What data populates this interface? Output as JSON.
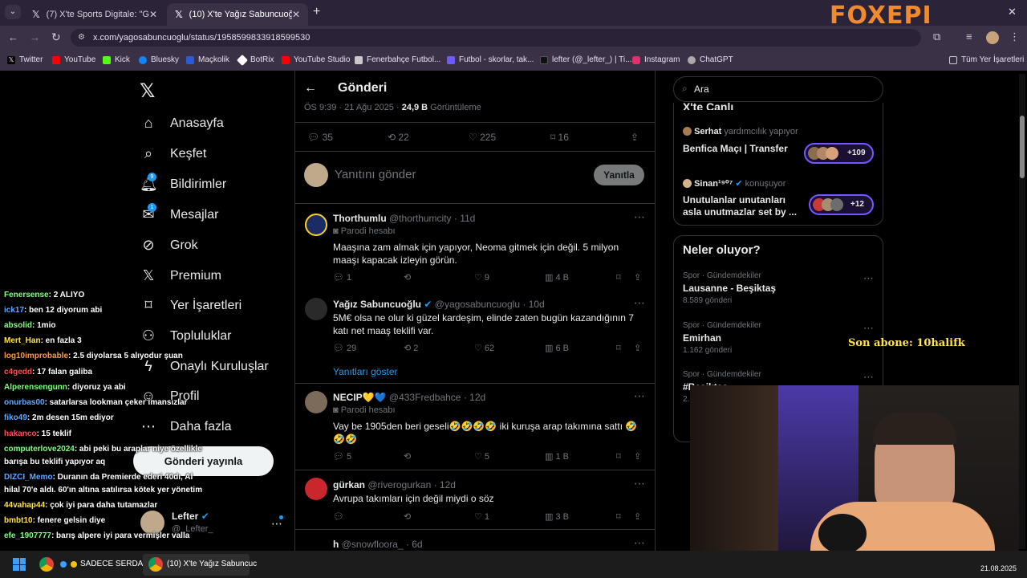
{
  "browser": {
    "tabs": [
      {
        "title": "(7) X'te Sports Digitale: \"Galata",
        "active": false
      },
      {
        "title": "(10) X'te Yağız Sabuncuoğlu: \"©",
        "active": true
      }
    ],
    "url": "x.com/yagosabuncuoglu/status/1958599833918599530",
    "bookmarks": [
      "Twitter",
      "YouTube",
      "Kick",
      "Bluesky",
      "Maçkolik",
      "BotRix",
      "YouTube Studio",
      "Fenerbahçe Futbol...",
      "Futbol - skorlar, tak...",
      "lefter (@_lefter_) | Ti...",
      "Instagram",
      "ChatGPT"
    ],
    "all_bookmarks": "Tüm Yer İşaretleri",
    "watermark": "FOXEPI"
  },
  "nav": {
    "items": [
      "Anasayfa",
      "Keşfet",
      "Bildirimler",
      "Mesajlar",
      "Grok",
      "Premium",
      "Yer İşaretleri",
      "Topluluklar",
      "Onaylı Kuruluşlar",
      "Profil",
      "Daha fazla"
    ],
    "notif_badge": "9",
    "msg_badge": "1",
    "post_button": "Gönderi yayınla",
    "account_name": "Lefter",
    "account_handle": "@_Lefter_"
  },
  "post": {
    "header": "Gönderi",
    "timestamp": "ÖS 9:39 · 21 Ağu 2025 · ",
    "views_count": "24,9 B",
    "views_label": " Görüntüleme",
    "replies": "35",
    "reposts": "22",
    "likes": "225",
    "bookmarks": "16",
    "reply_placeholder": "Yanıtını gönder",
    "reply_button": "Yanıtla"
  },
  "replies": [
    {
      "name": "Thorthumlu",
      "handle": "@thorthumcity · 11d",
      "parody": "Parodi hesabı",
      "text": "Maaşına zam almak için yapıyor, Neoma gitmek için değil. 5 milyon maaşı kapacak izleyin görün.",
      "r": "1",
      "rt": "",
      "l": "9",
      "v": "4 B"
    },
    {
      "name": "Yağız Sabuncuoğlu",
      "handle": "@yagosabuncuoglu · 10d",
      "parody": "",
      "text": "5M€ olsa ne olur ki güzel kardeşim, elinde zaten bugün kazandığının 7 katı net maaş teklifi var.",
      "r": "29",
      "rt": "2",
      "l": "62",
      "v": "6 B"
    },
    {
      "name": "NECIP💛💙",
      "handle": "@433Fredbahce · 12d",
      "parody": "Parodi hesabı",
      "text": "Vay be 1905den beri geseli🤣🤣🤣🤣 iki kuruşa arap takımına sattı 🤣🤣🤣",
      "r": "5",
      "rt": "",
      "l": "5",
      "v": "1 B"
    },
    {
      "name": "gürkan",
      "handle": "@riverogurkan · 12d",
      "parody": "",
      "text": "Avrupa takımları için değil miydi o söz",
      "r": "",
      "rt": "",
      "l": "1",
      "v": "3 B"
    },
    {
      "name": "h",
      "handle": "@snowfloora_ · 6d",
      "parody": "",
      "text": "",
      "r": "",
      "rt": "",
      "l": "",
      "v": ""
    }
  ],
  "show_replies": "Yanıtları göster",
  "search_placeholder": "Ara",
  "spaces": {
    "title": "X'te Canlı",
    "items": [
      {
        "host": "Serhat",
        "role": "yardımcılık yapıyor",
        "title": "Benfica Maçı | Transfer",
        "count": "+109"
      },
      {
        "host": "Sinan¹⁹⁰⁷",
        "role": "konuşuyor",
        "title": "Unutulanlar unutanları asla unutmazlar set by ...",
        "count": "+12"
      }
    ]
  },
  "trends": {
    "title": "Neler oluyor?",
    "items": [
      {
        "cat": "Spor · Gündemdekiler",
        "name": "Lausanne - Beşiktaş",
        "count": "8.589 gönderi"
      },
      {
        "cat": "Spor · Gündemdekiler",
        "name": "Emirhan",
        "count": "1.162 gönderi"
      },
      {
        "cat": "Spor · Gündemdekiler",
        "name": "#Beşiktaş...",
        "count": "2..."
      }
    ]
  },
  "overlay": {
    "subscriber": "Son abone: 10halifk"
  },
  "chat": [
    {
      "user": "Fenersense",
      "msg": ": 2 ALIYO",
      "color": "#7fff7f"
    },
    {
      "user": "ick17",
      "msg": ": ben 12 diyorum abi",
      "color": "#5fa8ff"
    },
    {
      "user": "absolid",
      "msg": ": 1mio",
      "color": "#7fff7f"
    },
    {
      "user": "Mert_Han",
      "msg": ": en fazla 3",
      "color": "#ffe14d"
    },
    {
      "user": "log10improbable",
      "msg": ": 2.5 diyolarsa 5 alıyodur şuan",
      "color": "#ff9b3d"
    },
    {
      "user": "c4gedd",
      "msg": ": 17 falan galiba",
      "color": "#ff4d4d"
    },
    {
      "user": "Alperensengunn",
      "msg": ": diyoruz ya abi",
      "color": "#7fff7f"
    },
    {
      "user": "onurbas00",
      "msg": ": satarlarsa lookman çeker imansızlar",
      "color": "#5fa8ff"
    },
    {
      "user": "fiko49",
      "msg": ": 2m desen 15m ediyor",
      "color": "#5fa8ff"
    },
    {
      "user": "hakanco",
      "msg": ": 15 teklif",
      "color": "#ff4d4d"
    },
    {
      "user": "computerlove2024",
      "msg": ": abi peki bu araplar niye özellikle",
      "color": "#7fff7f"
    },
    {
      "user": "",
      "msg": "barışa bu teklifi yapıyor aq",
      "color": "#fff"
    },
    {
      "user": "DIZCI_Memo",
      "msg": ": Duranın da Premierde ederi 40dı, Al",
      "color": "#5fa8ff"
    },
    {
      "user": "",
      "msg": "hilal 70'e aldı. 60'ın altına satılırsa kötek yer yönetim",
      "color": "#fff"
    },
    {
      "user": "44vahap44",
      "msg": ": çok iyi para daha tutamazlar",
      "color": "#ffe14d"
    },
    {
      "user": "bmbt10",
      "msg": ": fenere gelsin diye",
      "color": "#ffe14d"
    },
    {
      "user": "efe_1907777",
      "msg": ": barış alpere iyi para vermişler valla",
      "color": "#7fff7f"
    }
  ],
  "taskbar": {
    "item1": "SADECE SERDAR",
    "item2": "(10) X'te Yağız Sabuncuc",
    "date": "21.08.2025"
  }
}
